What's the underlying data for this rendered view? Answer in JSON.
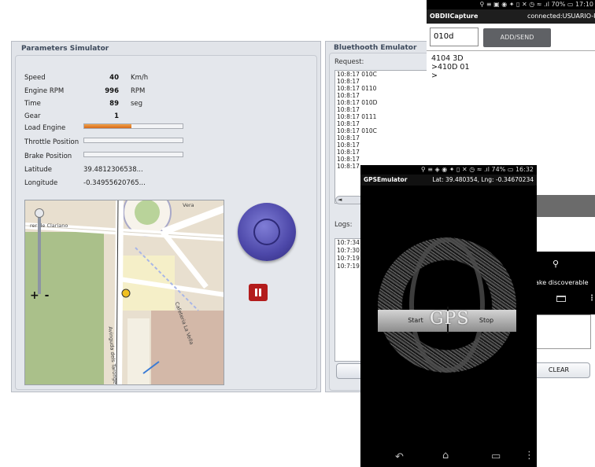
{
  "params": {
    "title": "Parameters Simulator",
    "rows": [
      {
        "label": "Speed",
        "value": "40",
        "unit": "Km/h"
      },
      {
        "label": "Engine RPM",
        "value": "996",
        "unit": "RPM"
      },
      {
        "label": "Time",
        "value": "89",
        "unit": "seg"
      },
      {
        "label": "Gear",
        "value": "1",
        "unit": ""
      }
    ],
    "bars": [
      {
        "label": "Load Engine",
        "fill": 0.48
      },
      {
        "label": "Throttle Position",
        "fill": 0
      },
      {
        "label": "Brake Position",
        "fill": 0
      }
    ],
    "latitude_label": "Latitude",
    "latitude_value": "39.4812306538...",
    "longitude_label": "Longitude",
    "longitude_value": "-0.34955620765...",
    "map": {
      "zoom_label": "+ -",
      "street_1": "rer de Clariano",
      "street_2": "Avinguda dels Tarongers",
      "street_3": "Cafeteria La Vella",
      "street_4": "Vera"
    }
  },
  "bluetooth": {
    "title": "Bluethooth Emulator",
    "request_label": "Request:",
    "request_lines": [
      "10:8:17 010C",
      "10:8:17",
      "10:8:17 0110",
      "10:8:17",
      "10:8:17 010D",
      "10:8:17",
      "10:8:17 0111",
      "10:8:17",
      "10:8:17 010C",
      "10:8:17",
      "10:8:17",
      "10:8:17",
      "10:8:17",
      "10:8:17"
    ],
    "scroll_label": "◄",
    "logs_label": "Logs:",
    "log_lines": [
      "10:7:34",
      "10:7:30",
      "10:7:19",
      "10:7:19"
    ]
  },
  "obd_phone": {
    "status": "⚲ ≡ ▣ ◉ ✦   ▯ ✕ ◷ ≈ .ıl 70% ▭ 17:10",
    "app_title": "OBDIICapture",
    "connection": "connected:USUARIO-PC",
    "input_value": "010d",
    "send_label": "ADD/SEND",
    "output_lines": [
      "4104 3D",
      ">410D 01",
      ">"
    ],
    "discoverable_label": "ake discoverable",
    "clear_label": "CLEAR"
  },
  "gps_phone": {
    "status": "⚲ ≡ ◈ ◉ ✦   ▯ ✕ ◷ ≈ .ıl 74% ▭ 16:32",
    "app_title": "GPSEmulator",
    "coords": "Lat: 39.480354, Lng: -0.34670234",
    "start_label": "Start",
    "stop_label": "Stop",
    "logo_text": "GPS",
    "nav_back": "↶",
    "nav_home": "⌂",
    "nav_recent": "▭",
    "nav_menu": "⋮"
  },
  "colors": {
    "load_fill": "#e0802e",
    "pause_button": "#b31c1c",
    "joystick": "#5552bd"
  }
}
